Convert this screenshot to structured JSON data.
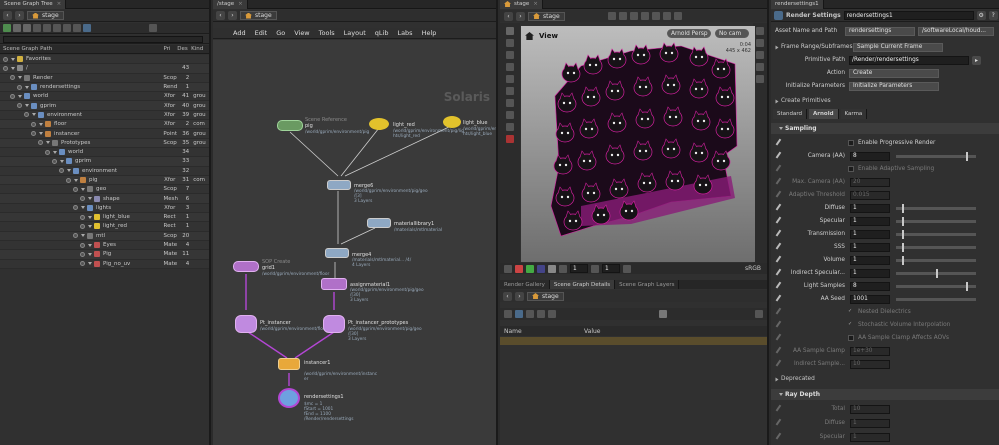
{
  "scene_graph": {
    "tab": "Scene Graph Tree",
    "path": "stage",
    "columns": {
      "path": "Scene Graph Path",
      "pri": "Pri",
      "des": "Des",
      "kind": "Kind"
    },
    "rows": [
      {
        "label": "Favorites",
        "indent": 0,
        "pri": "",
        "des": "",
        "kind": "",
        "icon": "star-icon"
      },
      {
        "label": "/",
        "indent": 0,
        "pri": "",
        "des": "43",
        "kind": "",
        "icon": "root-icon"
      },
      {
        "label": "Render",
        "indent": 1,
        "pri": "Scop",
        "des": "2",
        "kind": "",
        "icon": "scope-icon"
      },
      {
        "label": "rendersettings",
        "indent": 2,
        "pri": "Rend",
        "des": "1",
        "kind": "",
        "icon": "render-settings-icon"
      },
      {
        "label": "world",
        "indent": 1,
        "pri": "Xfor",
        "des": "41",
        "kind": "grou",
        "icon": "xform-icon"
      },
      {
        "label": "gprim",
        "indent": 2,
        "pri": "Xfor",
        "des": "40",
        "kind": "grou",
        "icon": "xform-icon"
      },
      {
        "label": "environment",
        "indent": 3,
        "pri": "Xfor",
        "des": "39",
        "kind": "grou",
        "icon": "xform-icon"
      },
      {
        "label": "floor",
        "indent": 4,
        "pri": "Xfor",
        "des": "2",
        "kind": "com",
        "icon": "floor-icon"
      },
      {
        "label": "instancer",
        "indent": 4,
        "pri": "Point",
        "des": "36",
        "kind": "grou",
        "icon": "instancer-icon"
      },
      {
        "label": "Prototypes",
        "indent": 5,
        "pri": "Scop",
        "des": "35",
        "kind": "grou",
        "icon": "scope-icon"
      },
      {
        "label": "world",
        "indent": 6,
        "pri": "",
        "des": "34",
        "kind": "",
        "icon": "xform-icon"
      },
      {
        "label": "gprim",
        "indent": 7,
        "pri": "",
        "des": "33",
        "kind": "",
        "icon": "xform-icon"
      },
      {
        "label": "environment",
        "indent": 8,
        "pri": "",
        "des": "32",
        "kind": "",
        "icon": "xform-icon"
      },
      {
        "label": "pig",
        "indent": 9,
        "pri": "Xfor",
        "des": "31",
        "kind": "com",
        "icon": "pig-icon"
      },
      {
        "label": "geo",
        "indent": 10,
        "pri": "Scop",
        "des": "7",
        "kind": "",
        "icon": "scope-icon"
      },
      {
        "label": "shape",
        "indent": 11,
        "pri": "Mesh",
        "des": "6",
        "kind": "",
        "icon": "mesh-icon"
      },
      {
        "label": "lights",
        "indent": 10,
        "pri": "Xfor",
        "des": "3",
        "kind": "",
        "icon": "xform-icon"
      },
      {
        "label": "light_blue",
        "indent": 11,
        "pri": "Rect",
        "des": "1",
        "kind": "",
        "icon": "light-icon"
      },
      {
        "label": "light_red",
        "indent": 11,
        "pri": "Rect",
        "des": "1",
        "kind": "",
        "icon": "light-icon"
      },
      {
        "label": "mtl",
        "indent": 10,
        "pri": "Scop",
        "des": "20",
        "kind": "",
        "icon": "scope-icon"
      },
      {
        "label": "Eyes",
        "indent": 11,
        "pri": "Mate",
        "des": "4",
        "kind": "",
        "icon": "material-icon"
      },
      {
        "label": "Pig",
        "indent": 11,
        "pri": "Mate",
        "des": "11",
        "kind": "",
        "icon": "material-icon"
      },
      {
        "label": "Pig_no_uv",
        "indent": 11,
        "pri": "Mate",
        "des": "4",
        "kind": "",
        "icon": "material-icon"
      }
    ]
  },
  "network": {
    "tab": "/stage",
    "path": "stage",
    "menu": [
      "Add",
      "Edit",
      "Go",
      "View",
      "Tools",
      "Layout",
      "qLib",
      "Labs",
      "Help"
    ],
    "watermark": "Solaris",
    "nodes": {
      "scene_import": {
        "title": "Scene Reference",
        "name": "pig",
        "sub": "/world/gprim/environment/pig"
      },
      "light_red": {
        "name": "light_red",
        "sub": "/world/gprim/environment/pig/lig\nhts/light_red"
      },
      "light_blue": {
        "name": "light_blue",
        "sub": "/world/gprim/environment/pig/lig\nhts/light_blue"
      },
      "merge6": {
        "name": "merge6",
        "sub": "/world/gprim/environment/pig/geo\n/[3]\n3 Layers"
      },
      "materiallibrary1": {
        "name": "materiallibrary1",
        "sub": "/materials/mtlmaterial"
      },
      "merge4": {
        "name": "merge4",
        "sub": "/materials/mtlmaterial... /4/\n4 Layers"
      },
      "grid1": {
        "title": "SOP Create",
        "name": "grid1",
        "sub": "/world/gprim/environment/floor"
      },
      "assignmaterial1": {
        "name": "assignmaterial1",
        "sub": "/world/gprim/environment/pig/geo\n/[30]\n3 Layers"
      },
      "pt_instancer": {
        "name": "Pt_instancer",
        "sub": "/world/gprim/environment/floor"
      },
      "pt_instancer_prototypes": {
        "name": "Pt_instancer_prototypes",
        "sub": "/world/gprim/environment/pig/geo\n/[30]\n3 Layers"
      },
      "instancer1": {
        "name": "instancer1",
        "sub": "/world/gprim/environment/instanc\ner"
      },
      "rendersettings1": {
        "name": "rendersettings1",
        "sub": "$mc = 1\nfStart = 1001\nfEnd = 1100\n/Render/rendersettings"
      }
    }
  },
  "viewer": {
    "tab": "stage",
    "path": "stage",
    "title": "View",
    "renderer": "Arnold Persp",
    "camera": "No cam",
    "stats": "0:04\n445 x 462",
    "frame": "1",
    "step": "1",
    "colorspace": "sRGB",
    "lower_tabs": [
      "Render Gallery",
      "Scene Graph Details",
      "Scene Graph Layers"
    ],
    "lower_path": "stage",
    "columns": {
      "name": "Name",
      "value": "Value"
    }
  },
  "params": {
    "tab": "Render Settings",
    "node_name": "rendersettings1",
    "asset_label": "Asset Name and Path",
    "asset_name": "rendersettings",
    "asset_path": "/softwareLocal/houd...",
    "frame_range": {
      "label": "Frame Range/Subframes",
      "value": "Sample Current Frame"
    },
    "primitive_path": {
      "label": "Primitive Path",
      "value": "/Render/rendersettings"
    },
    "action": {
      "label": "Action",
      "value": "Create"
    },
    "init": {
      "label": "Initialize Parameters",
      "value": "Initialize Parameters"
    },
    "create_primitives": "Create Primitives",
    "tabs": [
      "Standard",
      "Arnold",
      "Karma"
    ],
    "sampling": "Sampling",
    "progressive": "Enable Progressive Render",
    "camera_aa": {
      "label": "Camera (AA)",
      "value": "8",
      "level": 0.88
    },
    "adaptive": "Enable Adaptive Sampling",
    "max_camera_aa": {
      "label": "Max. Camera (AA)",
      "value": "20"
    },
    "adaptive_threshold": {
      "label": "Adaptive Threshold",
      "value": "0.015"
    },
    "diffuse": {
      "label": "Diffuse",
      "value": "1",
      "level": 0.08
    },
    "specular": {
      "label": "Specular",
      "value": "1",
      "level": 0.08
    },
    "transmission": {
      "label": "Transmission",
      "value": "1",
      "level": 0.08
    },
    "sss": {
      "label": "SSS",
      "value": "1",
      "level": 0.08
    },
    "volume": {
      "label": "Volume",
      "value": "1",
      "level": 0.08
    },
    "indirect_specular": {
      "label": "Indirect Specular...",
      "value": "1",
      "level": 0.5
    },
    "light_samples": {
      "label": "Light Samples",
      "value": "8",
      "level": 0.88
    },
    "aa_seed": {
      "label": "AA Seed",
      "value": "1001"
    },
    "nested": "Nested Dielectrics",
    "stochastic": "Stochastic Volume Interpolation",
    "aa_clamp_aovs": "AA Sample Clamp Affects AOVs",
    "aa_clamp": {
      "label": "AA Sample Clamp",
      "value": "1e+30"
    },
    "indirect_sample": {
      "label": "Indirect Sample...",
      "value": "10"
    },
    "deprecated": "Deprecated",
    "ray_depth": "Ray Depth",
    "total": {
      "label": "Total",
      "value": "10"
    },
    "rd_diffuse": {
      "label": "Diffuse",
      "value": "1"
    },
    "rd_specular": {
      "label": "Specular",
      "value": "1"
    }
  },
  "colors": {
    "accent": "#d99a3a",
    "magenta": "#d41fa0",
    "selection": "#5a4d2c"
  }
}
